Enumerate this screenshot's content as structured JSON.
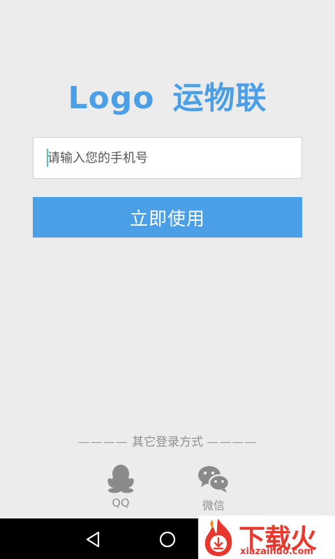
{
  "header": {
    "logo_text": "Logo",
    "app_name": "运物联",
    "accent_color": "#4a9fe6"
  },
  "login": {
    "phone_placeholder": "请输入您的手机号",
    "phone_value": "",
    "submit_label": "立即使用"
  },
  "other_login": {
    "dashes_left": "————",
    "title": "其它登录方式",
    "dashes_right": "————",
    "options": [
      {
        "label": "QQ",
        "icon": "qq-penguin-icon"
      },
      {
        "label": "微信",
        "icon": "wechat-icon"
      }
    ]
  },
  "system_nav": {
    "back_icon": "back-triangle-icon",
    "home_icon": "home-circle-icon"
  },
  "watermark": {
    "text": "下载火",
    "url": "xiazaihuo.com"
  }
}
